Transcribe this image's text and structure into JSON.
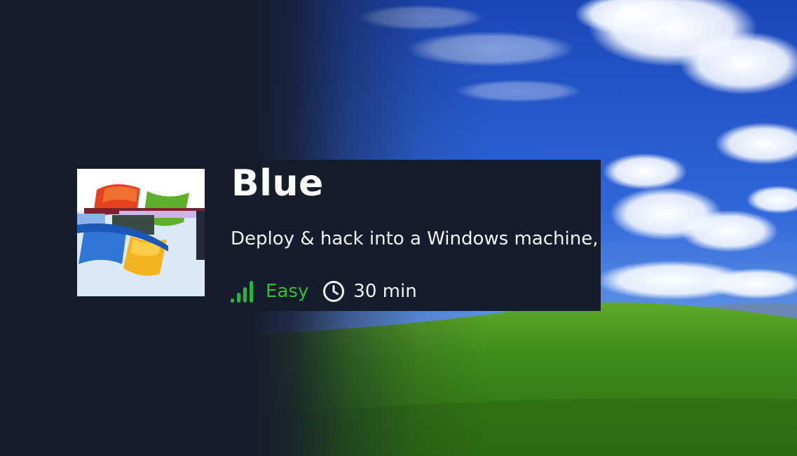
{
  "room": {
    "title": "Blue",
    "description": "Deploy & hack into a Windows machine,",
    "difficulty": "Easy",
    "duration": "30 min"
  },
  "icons": {
    "difficulty": "signal-bars-icon",
    "duration": "clock-icon",
    "thumbnail": "windows-logo"
  },
  "colors": {
    "page_background": "#161c2c",
    "card_background": "#151c2b",
    "difficulty_green": "#2fbf3f",
    "sky_blue": "#2a5fd0",
    "grass_green": "#3c8a1c"
  }
}
